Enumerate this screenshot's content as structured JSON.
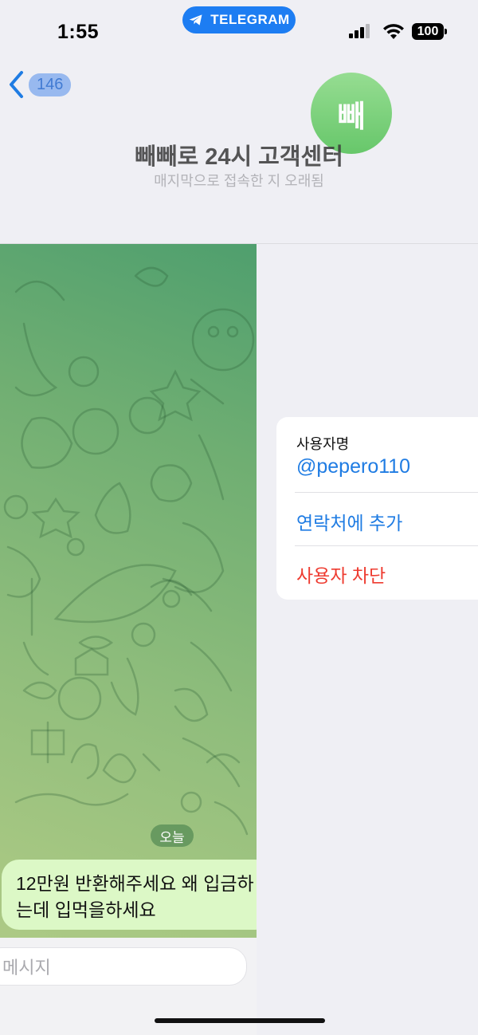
{
  "status_bar": {
    "time": "1:55",
    "app_pill": "TELEGRAM",
    "battery": "100"
  },
  "header": {
    "back_count": "146",
    "avatar_text": "빼",
    "title": "빼빼로 24시 고객센터",
    "subtitle": "매지막으로 접속한 지 오래됨"
  },
  "chat": {
    "date_chip": "오늘",
    "message": "12만원 반환해주세요 왜 입금하\n는데 입먹을하세요",
    "input_placeholder": "메시지"
  },
  "info_card": {
    "username_label": "사용자명",
    "username": "@pepero110",
    "add_contact": "연락처에 추가",
    "block_user": "사용자 차단"
  },
  "colors": {
    "accent": "#1f7ce3",
    "destructive": "#ee3b30",
    "telegram_blue": "#1d7df2",
    "bubble": "#dcf8c6",
    "avatar_green": "#6fcf6c"
  },
  "icons": [
    "telegram-plane-icon",
    "signal-icon",
    "wifi-icon",
    "battery-icon",
    "back-chevron-icon"
  ]
}
